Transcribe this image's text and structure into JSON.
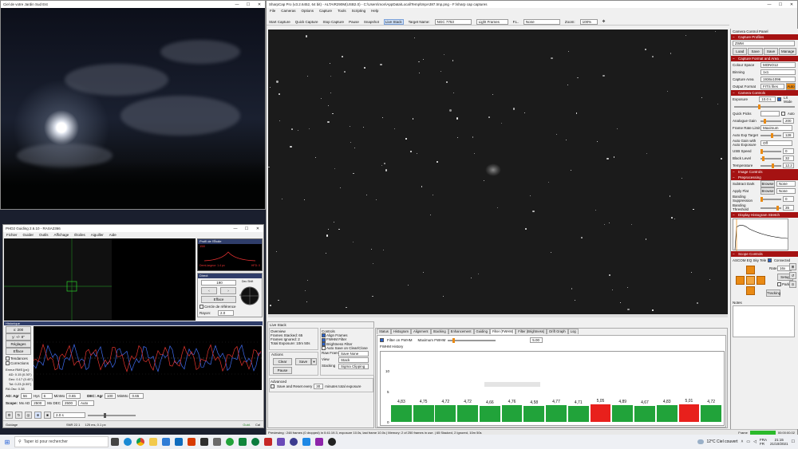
{
  "desktop": {
    "sky_window": {
      "title": "Ciel de votre Jardin Sud Est"
    },
    "phd": {
      "title": "PHD2 Guiding 2.6.10 - RASA2366",
      "menus": [
        "Fichier",
        "Guider",
        "Outils",
        "Affichage",
        "Étoiles",
        "Aiguiller",
        "Aide"
      ],
      "profile_title": "Profil de l'Étoile",
      "profile_value": "158",
      "profile_footer": "Demi-largeur: 1.4 px",
      "profile_right": "HFD: 0",
      "dock_label": "Direct",
      "dock_value": "190",
      "dock_btn": "Efface",
      "ref_check": "Cercle de référence",
      "radius_label": "Rayon:",
      "radius_value": "2.0",
      "north_label": "Dec Shift",
      "al_label": "AL",
      "graph_header": "Historique",
      "graph_scale1": "x: 200",
      "graph_scale2": "y: +/- 8\"",
      "graph_btn1": "Réglages",
      "graph_btn2": "Efface",
      "check_trends": "Tendances",
      "check_corrections": "Corrections",
      "rms_title": "Erreur RMS [px]:",
      "rms_ad": "AD: 0.15 (0.30\")",
      "rms_dec": "Dec: 0.17 (0.40\")",
      "rms_tot": "Tot: 0.23 (0.55\")",
      "ra_osc": "RA Osc: 0.38",
      "ad_label": "AD: Agr",
      "ad_agr": "56",
      "ad_hys_label": "Hys",
      "ad_hys": "6",
      "ad_min_label": "MinMo",
      "ad_min": "0.65",
      "dec_label": "DEC: Agr",
      "dec_agr": "100",
      "dec_min_label": "MinMo",
      "dec_min": "0.65",
      "scope_label": "Scope:",
      "scope_max_label": "Mx AD",
      "scope_max": "2500",
      "scope_maxdec_label": "Mx DEC",
      "scope_maxdec": "2500",
      "scope_mode": "Auto",
      "exposure_value": "2.0 s",
      "status_left": "Guidage",
      "status_snr": "SNR 22.1",
      "status_px": "125 ms, 0.1 px",
      "status_guide": "Guid.",
      "status_cal": "Cal"
    },
    "sharpcap": {
      "title": "SharpCap Pro (v3.2.6452, 64 bit) - ALTAIR290M(USB2.0) - C:\\Users\\mon\\AppData\\Local\\Temp\\tmpA387.tmp.png - F:\\sharp cap captures",
      "menus": [
        "File",
        "Cameras",
        "Options",
        "Capture",
        "Tools",
        "Scripting",
        "Help"
      ],
      "toolbar": [
        "Start Capture",
        "Quick Capture",
        "Stop Capture",
        "Pause",
        "Snapshot",
        "Live Stack"
      ],
      "target_label": "Target Name:",
      "target_value": "NGC 7753",
      "frames_value": "Light Frames",
      "fl_label": "F.L.",
      "fl_value": "None",
      "zoom_label": "Zoom:",
      "zoom_value": "100%",
      "status_bar": "Previewing : 248 frames (0 dropped) in 0:41:19.3, exposure 10.0s, last frame 10.0s | Memory: 2 of 250 frames in use. | 65 Stacked, 2 Ignored, 10m 50s",
      "frame_label": "Frame",
      "frame_time": "00:00:00.02"
    },
    "live_stack": {
      "header": "Live Stack",
      "overview_label": "Overview",
      "frames_stacked": "Frames Stacked: 65",
      "frames_ignored": "Frames Ignored: 2",
      "total_exposure": "Total Exposure: 10m 50s",
      "actions_label": "Actions",
      "btn_clear": "Clear",
      "btn_save": "Save",
      "btn_pause": "Pause",
      "controls_label": "Controls",
      "chk_align": "Align Frames",
      "chk_fwhm": "FWHM Filter",
      "chk_bright": "Brightness Filter",
      "chk_autosave": "Auto Save on Clear/Close",
      "raw_frames_label": "Raw Frames",
      "raw_frames_value": "Save None",
      "view_label": "View",
      "view_value": "Stack",
      "stacking_label": "Stacking",
      "stacking_value": "Sigma Clipping",
      "advanced_label": "Advanced",
      "save_reset": "Save and Reset every",
      "save_reset_value": "30",
      "save_reset_suffix": "minutes total exposure"
    },
    "fwhm": {
      "tabs": [
        "Status",
        "Histogram",
        "Alignment",
        "Stacking",
        "Enhancement",
        "Guiding",
        "Filter (FWHM)",
        "Filter (Brightness)",
        "Drift Graph",
        "Log"
      ],
      "filter_label": "Filter on FWHM",
      "max_label": "Maximum FWHM",
      "max_value": "5.00",
      "history_label": "FWHM History",
      "y_ticks": [
        "10",
        "5",
        "0"
      ],
      "values": [
        4.83,
        4.75,
        4.72,
        4.72,
        4.66,
        4.76,
        4.58,
        4.77,
        4.71,
        5.05,
        4.89,
        4.67,
        4.83,
        5.01,
        4.72
      ],
      "labels": [
        "4,83",
        "4,75",
        "4,72",
        "4,72",
        "4,66",
        "4,76",
        "4,58",
        "4,77",
        "4,71",
        "5,05",
        "4,89",
        "4,67",
        "4,83",
        "5,01",
        "4,72"
      ],
      "threshold": 5.0,
      "color_ok": "#21a33a",
      "color_rejected": "#e8201c"
    },
    "camera_panel": {
      "title": "Camera Control Panel",
      "capture_profiles": "Capture Profiles",
      "profile_value": "ZWM",
      "profile_btns": [
        "Load",
        "Save",
        "Save As",
        "Manage"
      ],
      "format_head": "Capture Format and Area",
      "colour_space_label": "Colour Space",
      "colour_space": "MONO12",
      "binning_label": "Binning",
      "binning": "1x1",
      "capture_area_label": "Capture Area",
      "capture_area": "1936x1096",
      "output_label": "Output Format",
      "output": "FITS files",
      "output_btn": "Auto",
      "controls_head": "Camera Controls",
      "exposure_label": "Exposure",
      "exposure": "10.0 s",
      "lx_label": "LX Mode",
      "quick_label": "Quick Picks",
      "auto_label": "Auto",
      "gain_label": "Analogue Gain",
      "gain": "200",
      "framerate_label": "Frame Rate Limit",
      "framerate": "Maximum",
      "autoexp_label": "Auto Exp Target",
      "autoexp": "128",
      "autogain_label": "Auto Gain with Auto Exposure",
      "autogain": "Off",
      "usb_label": "USB Speed",
      "usb": "0",
      "black_label": "Black Level",
      "black": "32",
      "temp_label": "Temperature",
      "temp": "12.2",
      "image_controls": "Image Controls",
      "preprocessing": "Preprocessing",
      "subtract_label": "Subtract Dark",
      "subtract": "None",
      "flat_label": "Apply Flat",
      "flat": "None",
      "banding_label": "Banding Suppression",
      "banding": "0",
      "threshold_label": "Banding Threshold",
      "threshold": "35",
      "histogram_head": "Display Histogram Stretch",
      "scope_head": "Scope Controls",
      "scope_name": "ASCOM EQ Sky Telescope",
      "connected": "Connected",
      "rate_label": "Rate",
      "rate": "16x",
      "setup_btn": "Setup",
      "park_label": "Park",
      "tracking_btn": "Tracking",
      "notes_label": "Notes"
    },
    "taskbar": {
      "search": "Taper ici pour rechercher",
      "weather": "12°C Ciel couvert",
      "lang": "FRA",
      "lang2": "FR",
      "time": "21:15",
      "date": "21/10/2021"
    }
  }
}
